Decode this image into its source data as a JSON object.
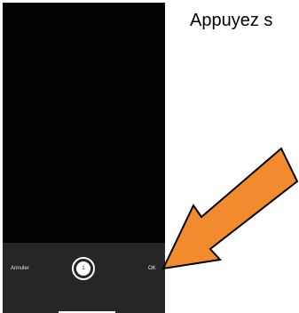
{
  "instruction": {
    "text": "Appuyez s"
  },
  "camera": {
    "cancel_label": "Annuler",
    "shutter_count": "1",
    "ok_label": "OK"
  },
  "arrow": {
    "color": "#f28a2e",
    "outline_color": "#000000",
    "icon": "arrow-down-left-icon"
  }
}
